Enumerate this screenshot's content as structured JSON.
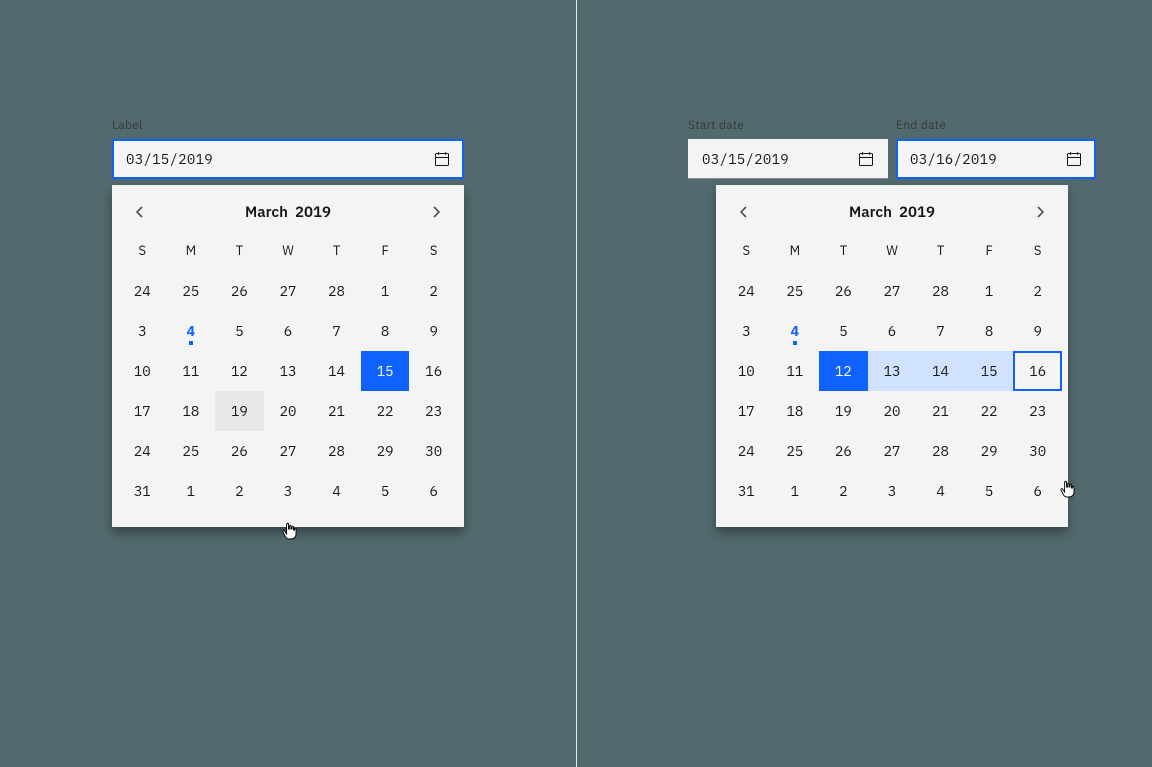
{
  "single": {
    "label": "Label",
    "value": "03/15/2019",
    "calendar": {
      "month_title": "March",
      "year": "2019",
      "dow": [
        "S",
        "M",
        "T",
        "W",
        "T",
        "F",
        "S"
      ],
      "weeks": [
        [
          {
            "n": 24,
            "out": true
          },
          {
            "n": 25,
            "out": true
          },
          {
            "n": 26,
            "out": true
          },
          {
            "n": 27,
            "out": true
          },
          {
            "n": 28,
            "out": true
          },
          {
            "n": 1
          },
          {
            "n": 2
          }
        ],
        [
          {
            "n": 3
          },
          {
            "n": 4,
            "today": true
          },
          {
            "n": 5
          },
          {
            "n": 6
          },
          {
            "n": 7
          },
          {
            "n": 8
          },
          {
            "n": 9
          }
        ],
        [
          {
            "n": 10
          },
          {
            "n": 11
          },
          {
            "n": 12
          },
          {
            "n": 13
          },
          {
            "n": 14
          },
          {
            "n": 15,
            "selected": true
          },
          {
            "n": 16
          }
        ],
        [
          {
            "n": 17
          },
          {
            "n": 18
          },
          {
            "n": 19,
            "hover": true
          },
          {
            "n": 20
          },
          {
            "n": 21
          },
          {
            "n": 22
          },
          {
            "n": 23
          }
        ],
        [
          {
            "n": 24
          },
          {
            "n": 25
          },
          {
            "n": 26
          },
          {
            "n": 27
          },
          {
            "n": 28
          },
          {
            "n": 29
          },
          {
            "n": 30
          }
        ],
        [
          {
            "n": 31
          },
          {
            "n": 1,
            "out": true
          },
          {
            "n": 2,
            "out": true
          },
          {
            "n": 3,
            "out": true
          },
          {
            "n": 4,
            "out": true
          },
          {
            "n": 5,
            "out": true
          },
          {
            "n": 6,
            "out": true
          }
        ]
      ]
    }
  },
  "range": {
    "start_label": "Start date",
    "end_label": "End date",
    "start_value": "03/15/2019",
    "end_value": "03/16/2019",
    "calendar": {
      "month_title": "March",
      "year": "2019",
      "dow": [
        "S",
        "M",
        "T",
        "W",
        "T",
        "F",
        "S"
      ],
      "weeks": [
        [
          {
            "n": 24,
            "out": true
          },
          {
            "n": 25,
            "out": true
          },
          {
            "n": 26,
            "out": true
          },
          {
            "n": 27,
            "out": true
          },
          {
            "n": 28,
            "out": true
          },
          {
            "n": 1
          },
          {
            "n": 2
          }
        ],
        [
          {
            "n": 3
          },
          {
            "n": 4,
            "today": true
          },
          {
            "n": 5
          },
          {
            "n": 6
          },
          {
            "n": 7
          },
          {
            "n": 8
          },
          {
            "n": 9
          }
        ],
        [
          {
            "n": 10
          },
          {
            "n": 11
          },
          {
            "n": 12,
            "range_start": true
          },
          {
            "n": 13,
            "in_range": true
          },
          {
            "n": 14,
            "in_range": true
          },
          {
            "n": 15,
            "in_range": true
          },
          {
            "n": 16,
            "range_end": true
          }
        ],
        [
          {
            "n": 17
          },
          {
            "n": 18
          },
          {
            "n": 19
          },
          {
            "n": 20
          },
          {
            "n": 21
          },
          {
            "n": 22
          },
          {
            "n": 23
          }
        ],
        [
          {
            "n": 24
          },
          {
            "n": 25
          },
          {
            "n": 26
          },
          {
            "n": 27
          },
          {
            "n": 28
          },
          {
            "n": 29
          },
          {
            "n": 30
          }
        ],
        [
          {
            "n": 31
          },
          {
            "n": 1,
            "out": true
          },
          {
            "n": 2,
            "out": true
          },
          {
            "n": 3,
            "out": true
          },
          {
            "n": 4,
            "out": true
          },
          {
            "n": 5,
            "out": true
          },
          {
            "n": 6,
            "out": true
          }
        ]
      ]
    }
  }
}
